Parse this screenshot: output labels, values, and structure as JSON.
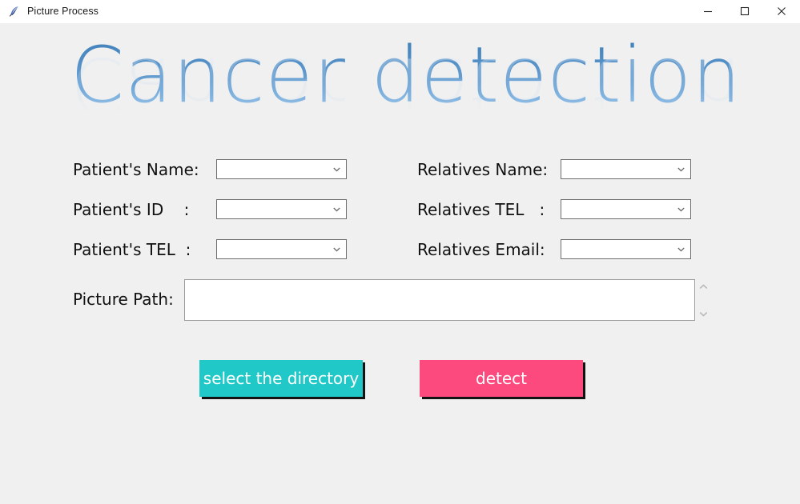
{
  "window": {
    "title": "Picture Process",
    "icon": "feather-icon",
    "background_color": "#f0f0f0",
    "titlebar_color": "#ffffff",
    "controls": [
      {
        "name": "minimize",
        "glyph": "minimize-icon"
      },
      {
        "name": "maximize",
        "glyph": "maximize-icon"
      },
      {
        "name": "close",
        "glyph": "close-icon"
      }
    ]
  },
  "heading": {
    "text": "Cancer detection",
    "gradient_top": "#3e7fb8",
    "gradient_bottom": "#a9cff0"
  },
  "form": {
    "left_column": [
      {
        "label": "Patient's Name:",
        "value": "",
        "control": "combobox"
      },
      {
        "label": "Patient's ID    :",
        "value": "",
        "control": "combobox"
      },
      {
        "label": "Patient's TEL  :",
        "value": "",
        "control": "combobox"
      }
    ],
    "right_column": [
      {
        "label": "Relatives Name:",
        "value": "",
        "control": "combobox"
      },
      {
        "label": "Relatives TEL   :",
        "value": "",
        "control": "combobox"
      },
      {
        "label": "Relatives Email:",
        "value": "",
        "control": "combobox"
      }
    ],
    "picture_path": {
      "label": "Picture Path:",
      "value": "",
      "control": "textarea",
      "scrollbar": {
        "up": "chevron-up-icon",
        "down": "chevron-down-icon"
      }
    }
  },
  "buttons": {
    "select_directory": {
      "label": "select the directory",
      "color": "#20c9c7",
      "text_color": "#ffffff",
      "shadow_color": "#131313"
    },
    "detect": {
      "label": "detect",
      "color": "#fc4a7e",
      "text_color": "#ffffff",
      "shadow_color": "#131313"
    }
  }
}
